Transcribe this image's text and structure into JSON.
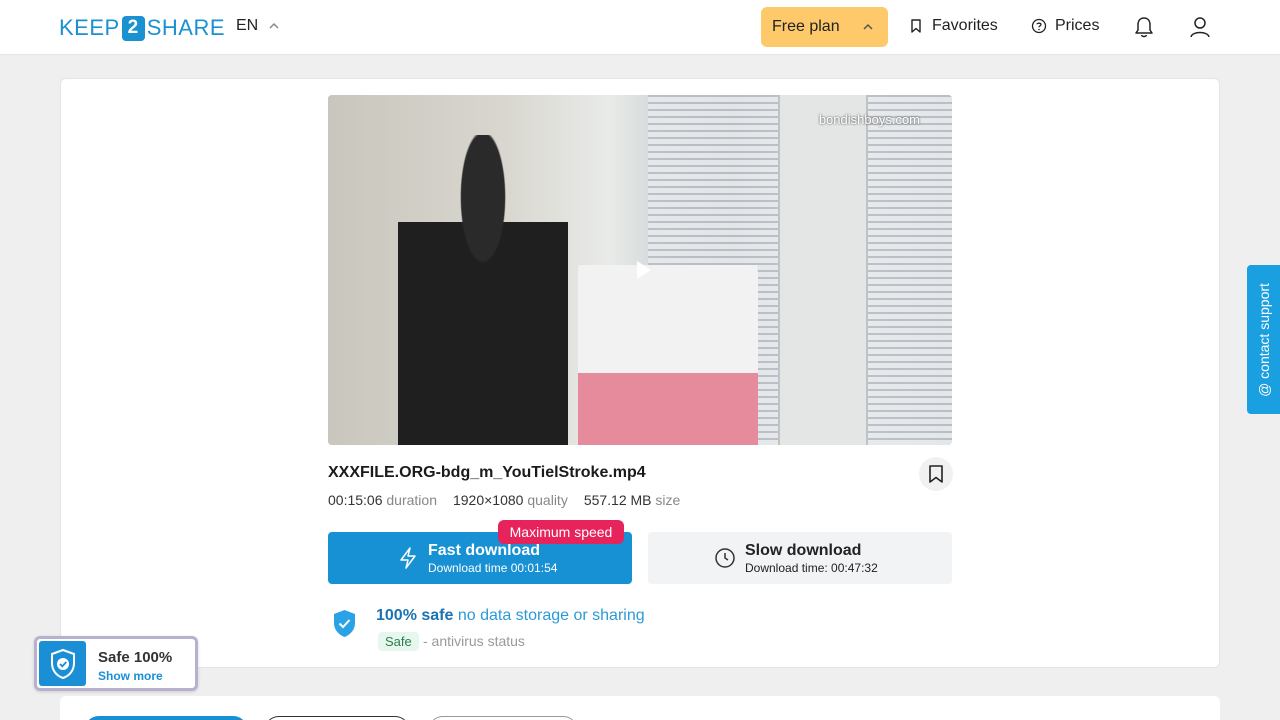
{
  "header": {
    "logo_left": "KEEP",
    "logo_mid": "2",
    "logo_right": "SHARE",
    "lang": "EN",
    "plan_label": "Free plan",
    "favorites_label": "Favorites",
    "prices_label": "Prices"
  },
  "video": {
    "watermark": "bondishboys.com"
  },
  "file": {
    "name": "XXXFILE.ORG-bdg_m_YouTielStroke.mp4",
    "duration": "00:15:06",
    "duration_label": "duration",
    "quality": "1920×1080",
    "quality_label": "quality",
    "size": "557.12 MB",
    "size_label": "size"
  },
  "download": {
    "fast_title": "Fast download",
    "fast_time": "Download time 00:01:54",
    "badge": "Maximum speed",
    "slow_title": "Slow download",
    "slow_time": "Download time: 00:47:32"
  },
  "safety": {
    "strong": "100% safe",
    "rest": "no data storage or sharing",
    "tag": "Safe",
    "status": "- antivirus status"
  },
  "safe_widget": {
    "title": "Safe 100%",
    "more": "Show more"
  },
  "contact": {
    "label": "@ contact support"
  },
  "colors": {
    "accent": "#1890d4",
    "plan": "#fdc96b",
    "badge": "#e6235a"
  }
}
